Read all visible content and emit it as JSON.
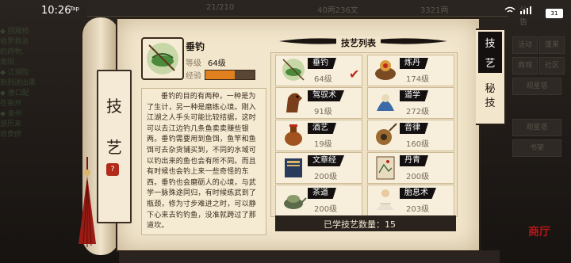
{
  "status_bar": {
    "time": "10:26",
    "tag": "Tap",
    "battery": "31"
  },
  "background": {
    "top_items": [
      "21/210",
      "40两236文",
      "3321两",
      "公告"
    ],
    "log_lines": [
      "◆ 回厢修",
      "收罗救治",
      "的药物,",
      "青阳",
      "◆ 江湖险",
      "到则送出黑",
      "◆ 港口配",
      "在泉州",
      "◆ 泉州",
      "游历来",
      "收费修"
    ],
    "side_buttons": [
      "活动",
      "蓬莱",
      "商城",
      "社区",
      "观星塔",
      "中西",
      "书架"
    ]
  },
  "scroll_title": [
    "技",
    "艺"
  ],
  "scroll_seal": "?",
  "selected_skill": {
    "name": "垂钓",
    "level_label": "等级",
    "level_value": "64级",
    "exp_label": "经验",
    "exp_fraction": 0.6,
    "description": "垂钓的目的有两种，一种是为了生计，另一种是磨练心境。刚入江湖之人手头可能比较拮据，这时可以去江边钓几条鱼卖卖赚些银两。垂钓需要用到鱼饵，鱼竿和鱼饵可去杂货铺买到，不同的水域可以钓出来的鱼也会有所不同。而且有时候也会钓上来一些奇怪的东西。垂钓也会磨砺人的心境，与武学一脉殊途同归，有时候练武到了瓶颈，修为寸步难进之时，可以静下心来去钓钓鱼，没准就跨过了那道坎。"
  },
  "skill_list": {
    "title": "技艺列表",
    "items": [
      {
        "name": "垂钓",
        "level": "64级",
        "icon": "fishing-icon",
        "selected": true
      },
      {
        "name": "炼丹",
        "level": "174级",
        "icon": "alchemy-icon",
        "selected": false
      },
      {
        "name": "驾驭术",
        "level": "91级",
        "icon": "horse-icon",
        "selected": false
      },
      {
        "name": "道学",
        "level": "272级",
        "icon": "taoism-icon",
        "selected": false
      },
      {
        "name": "酒艺",
        "level": "19级",
        "icon": "wine-icon",
        "selected": false
      },
      {
        "name": "音律",
        "level": "160级",
        "icon": "music-icon",
        "selected": false
      },
      {
        "name": "文章经",
        "level": "200级",
        "icon": "book-icon",
        "selected": false
      },
      {
        "name": "丹青",
        "level": "200级",
        "icon": "painting-icon",
        "selected": false
      },
      {
        "name": "茶道",
        "level": "200级",
        "icon": "tea-icon",
        "selected": false
      },
      {
        "name": "胎息术",
        "level": "203级",
        "icon": "meditation-icon",
        "selected": false
      }
    ],
    "learned_label": "已学技艺数量：",
    "learned_count": "15"
  },
  "tabs": {
    "skill": [
      "技",
      "艺"
    ],
    "secret": [
      "秘",
      "技"
    ]
  },
  "corner_text": "商厅",
  "colors": {
    "accent_orange": "#e0801e",
    "check_red": "#c0281a",
    "label_bg": "#141010",
    "parchment": "#f2e6cc"
  }
}
